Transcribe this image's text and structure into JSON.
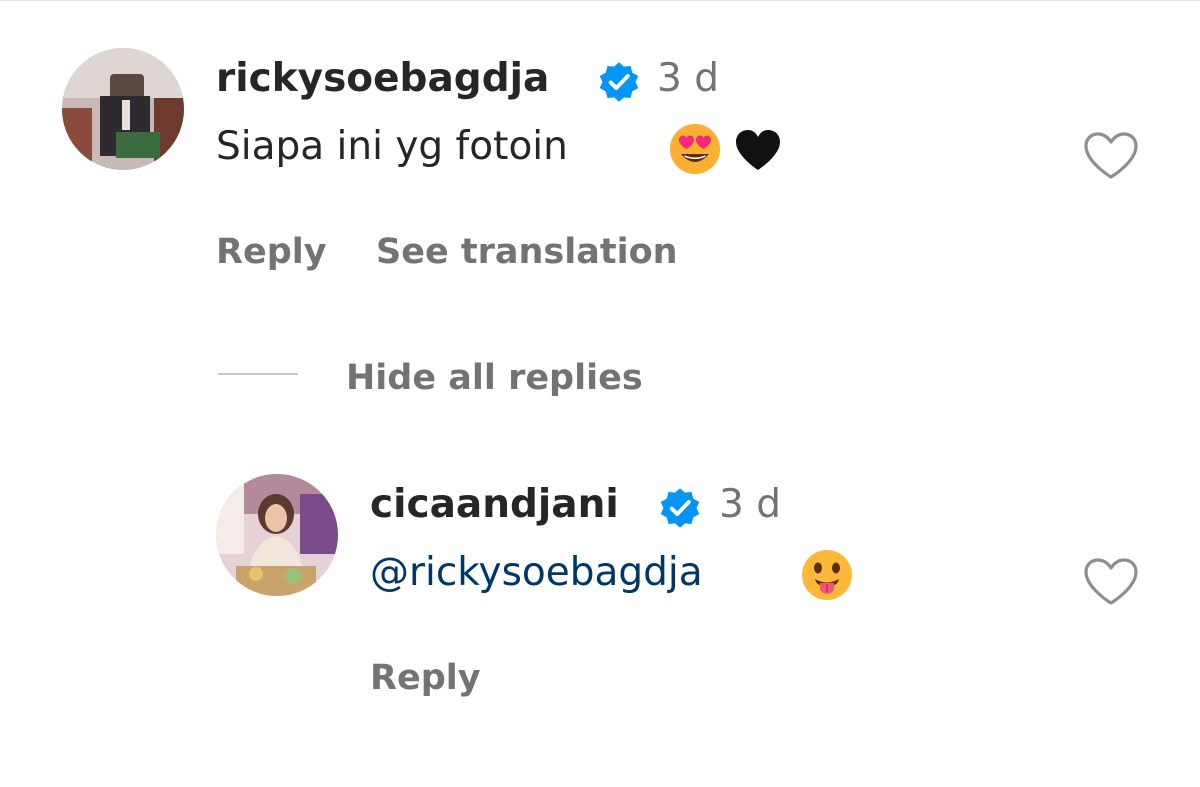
{
  "comment": {
    "username": "rickysoebagdja",
    "verified_icon": "verified-badge-icon",
    "timestamp": "3 d",
    "text": "Siapa ini yg fotoin",
    "emojis": [
      "heart-eyes-emoji",
      "black-heart-emoji"
    ],
    "reply_label": "Reply",
    "translation_label": "See translation",
    "like_icon": "heart-outline-icon"
  },
  "replies_toggle": {
    "label": "Hide all replies"
  },
  "reply": {
    "username": "cicaandjani",
    "verified_icon": "verified-badge-icon",
    "timestamp": "3 d",
    "mention": "@rickysoebagdja",
    "emojis": [
      "tongue-out-emoji"
    ],
    "reply_label": "Reply",
    "like_icon": "heart-outline-icon"
  },
  "colors": {
    "verified": "#0095f6",
    "mention": "#00376b",
    "muted": "#737373",
    "text": "#262626"
  }
}
